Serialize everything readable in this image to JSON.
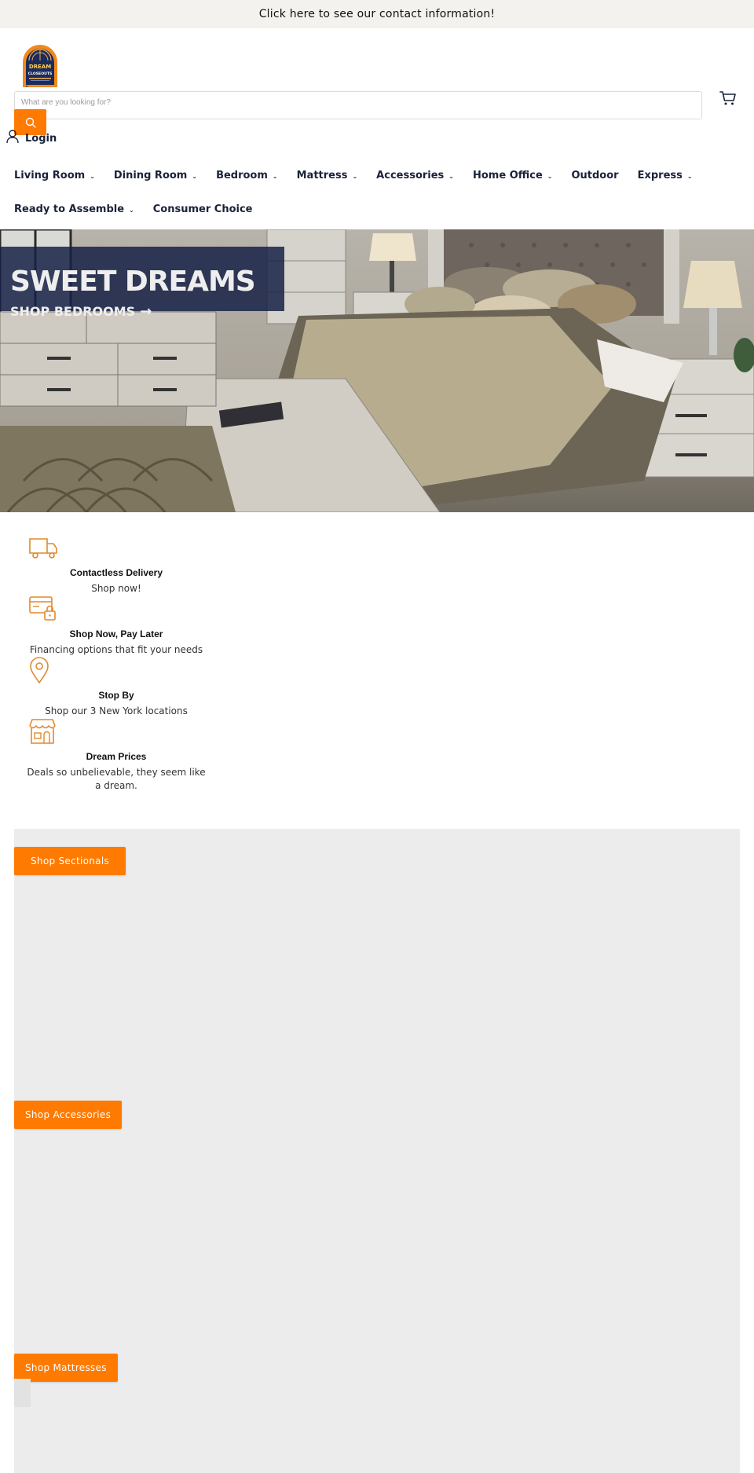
{
  "announcement": {
    "text": "Click here to see our contact information!"
  },
  "logo": {
    "text_line1": "DREAM",
    "text_line2": "CLOSEOUTS"
  },
  "search": {
    "placeholder": "What are you looking for?"
  },
  "account": {
    "login_label": "Login"
  },
  "nav": {
    "row1": [
      {
        "label": "Living Room",
        "has_dropdown": true
      },
      {
        "label": "Dining Room",
        "has_dropdown": true
      },
      {
        "label": "Bedroom",
        "has_dropdown": true
      },
      {
        "label": "Mattress",
        "has_dropdown": true
      },
      {
        "label": "Accessories",
        "has_dropdown": true
      },
      {
        "label": "Home Office",
        "has_dropdown": true
      },
      {
        "label": "Outdoor",
        "has_dropdown": false
      },
      {
        "label": "Express",
        "has_dropdown": true
      }
    ],
    "row2": [
      {
        "label": "Ready to Assemble",
        "has_dropdown": true
      },
      {
        "label": "Consumer Choice",
        "has_dropdown": false
      }
    ],
    "chevron": "⌄"
  },
  "hero": {
    "title": "SWEET DREAMS",
    "cta": "SHOP BEDROOMS",
    "cta_arrow": "→"
  },
  "features": [
    {
      "icon": "delivery-truck-icon",
      "title": "Contactless Delivery",
      "subtitle": "Shop now!"
    },
    {
      "icon": "credit-card-lock-icon",
      "title": "Shop Now, Pay Later",
      "subtitle": "Financing options that fit your needs"
    },
    {
      "icon": "map-pin-icon",
      "title": "Stop By",
      "subtitle": "Shop our 3 New York locations"
    },
    {
      "icon": "storefront-icon",
      "title": "Dream Prices",
      "subtitle": "Deals so unbelievable, they seem like a dream."
    }
  ],
  "collections": [
    {
      "button_label": "Shop Sectionals"
    },
    {
      "button_label": "Shop Accessories"
    },
    {
      "button_label": "Shop Mattresses"
    }
  ],
  "colors": {
    "accent": "#ff7a00",
    "navy": "#1a2238",
    "announcement_bg": "#f3f2ee",
    "collections_bg": "#ececec"
  }
}
